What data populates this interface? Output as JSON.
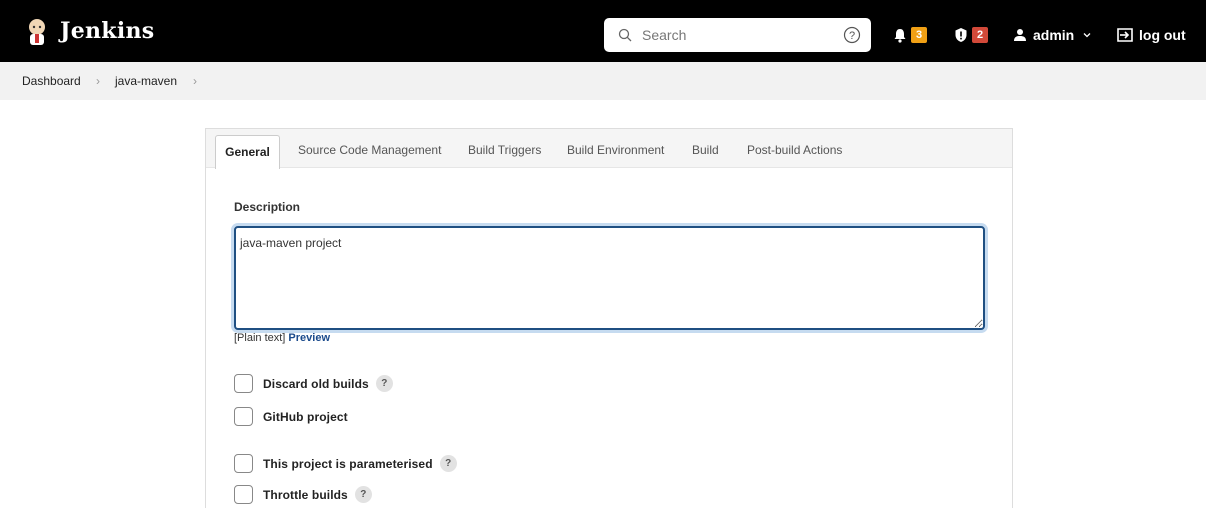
{
  "header": {
    "app_name": "Jenkins",
    "search_placeholder": "Search",
    "notifications_count": "3",
    "security_count": "2",
    "user": "admin",
    "logout": "log out"
  },
  "breadcrumb": [
    "Dashboard",
    "java-maven"
  ],
  "tabs": {
    "active": "General",
    "others": [
      "Source Code Management",
      "Build Triggers",
      "Build Environment",
      "Build",
      "Post-build Actions"
    ]
  },
  "description": {
    "label": "Description",
    "value": "java-maven project",
    "format_note": "[Plain text]",
    "preview_label": "Preview"
  },
  "options": [
    {
      "label": "Discard old builds",
      "help": "?"
    },
    {
      "label": "GitHub project"
    },
    {
      "label": "This project is parameterised",
      "help": "?"
    },
    {
      "label": "Throttle builds",
      "help": "?"
    }
  ],
  "colors": {
    "header_bg": "#000000",
    "accent": "#1a4a8c",
    "badge_orange": "#f0a015",
    "badge_red": "#d24939"
  },
  "icons": [
    "jenkins-logo-icon",
    "search-icon",
    "help-circle-icon",
    "bell-icon",
    "shield-icon",
    "user-icon",
    "chevron-down-icon",
    "logout-icon",
    "chevron-right-icon",
    "question-icon"
  ]
}
